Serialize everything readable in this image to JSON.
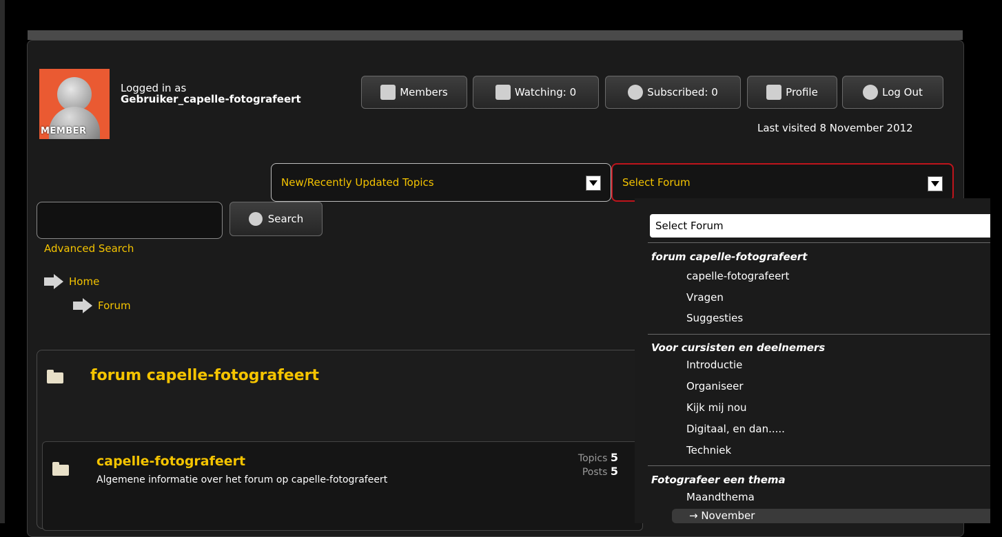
{
  "header": {
    "avatar_label": "MEMBER",
    "logged_in_as": "Logged in as",
    "username": "Gebruiker_capelle-fotografeert",
    "buttons": {
      "members": "Members",
      "watching": "Watching: 0",
      "subscribed": "Subscribed: 0",
      "profile": "Profile",
      "logout": "Log Out"
    },
    "last_visited": "Last visited 8 November 2012"
  },
  "dropdowns": {
    "topics": "New/Recently Updated Topics",
    "forum": "Select Forum"
  },
  "search": {
    "button": "Search",
    "advanced": "Advanced Search",
    "value": ""
  },
  "breadcrumb": [
    "Home",
    "Forum"
  ],
  "category": {
    "title": "forum capelle-fotografeert",
    "forums": [
      {
        "title": "capelle-fotografeert",
        "description": "Algemene informatie over het forum op capelle-fotografeert",
        "topics_label": "Topics",
        "topics": "5",
        "posts_label": "Posts",
        "posts": "5"
      }
    ]
  },
  "forum_menu": {
    "selected": "Select Forum",
    "groups": [
      {
        "name": "forum capelle-fotografeert",
        "options": [
          "capelle-fotografeert",
          "Vragen",
          "Suggesties"
        ]
      },
      {
        "name": "Voor cursisten en deelnemers",
        "options": [
          "Introductie",
          "Organiseer",
          "Kijk mij nou",
          "Digitaal, en dan.....",
          "Techniek"
        ]
      },
      {
        "name": "Fotografeer een thema",
        "options": [
          "Maandthema",
          "→ November"
        ]
      }
    ]
  },
  "colors": {
    "accent": "#f5c400",
    "background": "#1b1b1b",
    "avatar_bg": "#ea5a32",
    "focus_border": "#c0141c"
  }
}
